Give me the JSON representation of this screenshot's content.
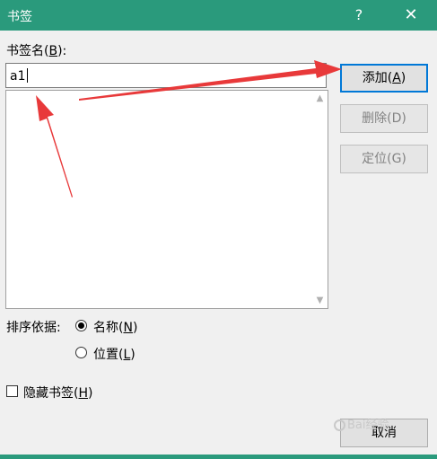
{
  "window": {
    "title": "书签",
    "help_label": "?",
    "close_label": "✕"
  },
  "bookmark_name": {
    "label_prefix": "书签名(",
    "label_key": "B",
    "label_suffix": "):",
    "value": "a1"
  },
  "buttons": {
    "add": {
      "text": "添加(",
      "key": "A",
      "suffix": ")"
    },
    "delete": {
      "text": "删除(D)"
    },
    "goto": {
      "text": "定位(G)"
    },
    "cancel": {
      "text": "取消"
    }
  },
  "sort": {
    "label": "排序依据:",
    "options": [
      {
        "text": "名称(",
        "key": "N",
        "suffix": ")",
        "checked": true
      },
      {
        "text": "位置(",
        "key": "L",
        "suffix": ")",
        "checked": false
      }
    ]
  },
  "hidden": {
    "text": "隐藏书签(",
    "key": "H",
    "suffix": ")",
    "checked": false
  },
  "watermark": {
    "text": "Bai经验"
  },
  "colors": {
    "titlebar": "#2a9a7c",
    "arrow": "#e8393a",
    "focus": "#0078d7"
  }
}
